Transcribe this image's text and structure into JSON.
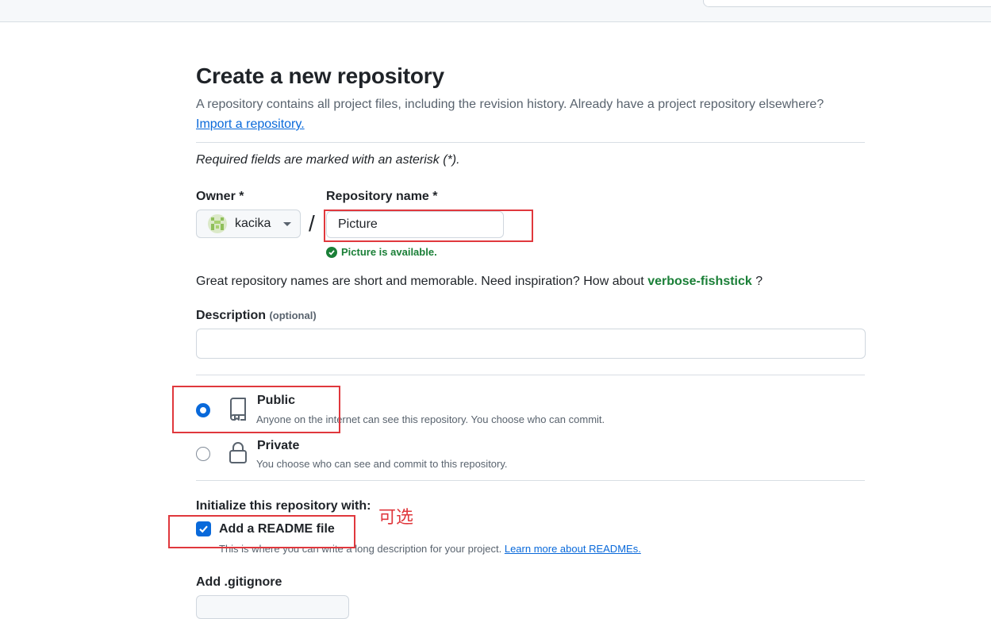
{
  "header": {
    "title": "Create a new repository",
    "subtitle": "A repository contains all project files, including the revision history. Already have a project repository elsewhere?",
    "import_link": "Import a repository."
  },
  "required_note": "Required fields are marked with an asterisk (*).",
  "owner": {
    "label": "Owner *",
    "value": "kacika"
  },
  "separator": "/",
  "repo_name": {
    "label": "Repository name *",
    "value": "Picture",
    "availability": "Picture is available."
  },
  "name_hint": {
    "prefix": "Great repository names are short and memorable. Need inspiration? How about ",
    "suggestion": "verbose-fishstick",
    "suffix": " ?"
  },
  "description": {
    "label": "Description",
    "optional": "(optional)",
    "value": ""
  },
  "visibility": {
    "public": {
      "title": "Public",
      "desc": "Anyone on the internet can see this repository. You choose who can commit.",
      "selected": true,
      "icon": "repo-icon"
    },
    "private": {
      "title": "Private",
      "desc": "You choose who can see and commit to this repository.",
      "selected": false,
      "icon": "lock-icon"
    }
  },
  "init": {
    "heading": "Initialize this repository with:",
    "readme_label": "Add a README file",
    "readme_checked": true,
    "readme_desc": "This is where you can write a long description for your project.",
    "readme_link": "Learn more about READMEs."
  },
  "annotation": "可选",
  "gitignore": {
    "label": "Add .gitignore"
  },
  "colors": {
    "accent": "#0969da",
    "success": "#1a7f37",
    "annotation_red": "#e0383d"
  }
}
